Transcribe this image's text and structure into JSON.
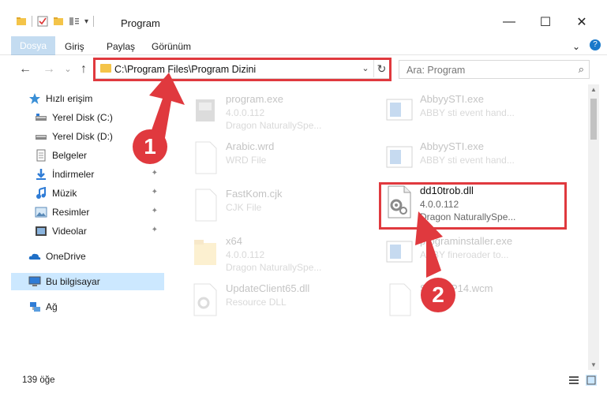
{
  "window": {
    "title": "Program",
    "minimize_glyph": "—",
    "maximize_glyph": "☐",
    "close_glyph": "✕"
  },
  "ribbon": {
    "tabs": [
      "Dosya",
      "Giriş",
      "Paylaş",
      "Görünüm"
    ],
    "expand_glyph": "⌄",
    "help_glyph": "?"
  },
  "nav": {
    "back_glyph": "←",
    "forward_glyph": "→",
    "recent_glyph": "⌄",
    "up_glyph": "↑",
    "address_path": "C:\\Program Files\\Program Dizini",
    "address_dropdown_glyph": "⌄",
    "refresh_glyph": "↻",
    "search_placeholder": "Ara: Program",
    "search_glyph": "⌕"
  },
  "sidebar": {
    "items": [
      {
        "label": "Hızlı erişim",
        "icon": "star-icon"
      },
      {
        "label": "Yerel Disk (C:)",
        "icon": "drive-icon"
      },
      {
        "label": "Yerel Disk (D:)",
        "icon": "drive-icon"
      },
      {
        "label": "Belgeler",
        "icon": "documents-icon"
      },
      {
        "label": "İndirmeler",
        "icon": "download-icon"
      },
      {
        "label": "Müzik",
        "icon": "music-icon"
      },
      {
        "label": "Resimler",
        "icon": "pictures-icon"
      },
      {
        "label": "Videolar",
        "icon": "video-icon"
      },
      {
        "label": "OneDrive",
        "icon": "cloud-icon"
      },
      {
        "label": "Bu bilgisayar",
        "icon": "computer-icon"
      },
      {
        "label": "Ağ",
        "icon": "network-icon"
      }
    ],
    "pin_glyph": "📌"
  },
  "files": [
    {
      "name": "program.exe",
      "line1": "4.0.0.112",
      "line2": "Dragon NaturallySpe..."
    },
    {
      "name": "AbbyySTI.exe",
      "line1": "ABBY sti event hand...",
      "line2": ""
    },
    {
      "name": "Arabic.wrd",
      "line1": "WRD File",
      "line2": ""
    },
    {
      "name": "AbbyySTI.exe",
      "line1": "ABBY sti event hand...",
      "line2": ""
    },
    {
      "name": "FastKom.cjk",
      "line1": "CJK File",
      "line2": ""
    },
    {
      "name": "dd10trob.dll",
      "line1": "4.0.0.112",
      "line2": "Dragon NaturallySpe..."
    },
    {
      "name": "x64",
      "line1": "4.0.0.112",
      "line2": "Dragon NaturallySpe..."
    },
    {
      "name": "programinstaller.exe",
      "line1": "ABBY fineroader to...",
      "line2": ""
    },
    {
      "name": "UpdateClient65.dll",
      "line1": "Resource DLL",
      "line2": ""
    },
    {
      "name": "SCBWP14.wcm",
      "line1": "",
      "line2": ""
    }
  ],
  "status": {
    "item_count": "139 öğe"
  },
  "annotations": {
    "marker1": "1",
    "marker2": "2",
    "color": "#e0393e"
  }
}
